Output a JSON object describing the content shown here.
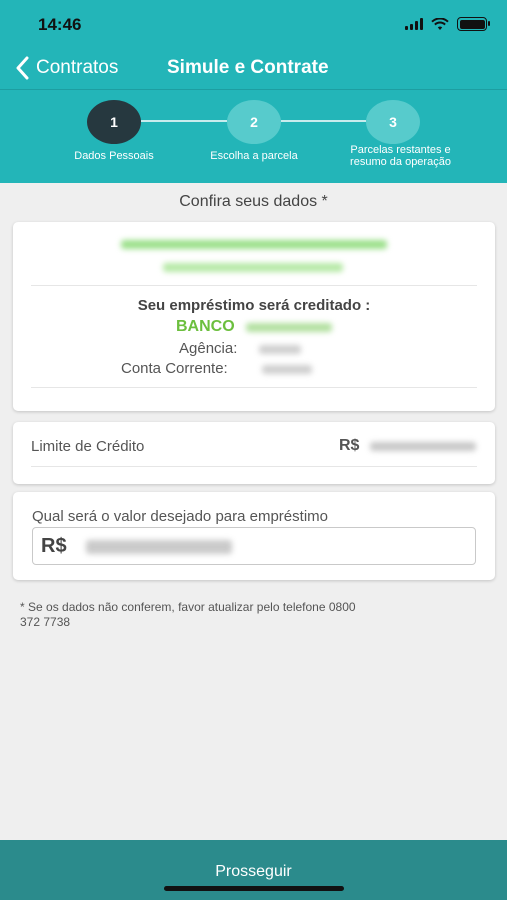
{
  "status_bar": {
    "time": "14:46"
  },
  "nav": {
    "back_label": "Contratos",
    "title": "Simule e Contrate"
  },
  "stepper": {
    "steps": [
      {
        "number": "1",
        "label": "Dados Pessoais",
        "active": true
      },
      {
        "number": "2",
        "label": "Escolha a parcela",
        "active": false
      },
      {
        "number": "3",
        "label_line1": "Parcelas restantes e",
        "label_line2": "resumo da operação",
        "active": false
      }
    ]
  },
  "section_title": "Confira seus dados *",
  "account_card": {
    "credit_heading": "Seu empréstimo será creditado :",
    "bank_label": "BANCO",
    "agency_label": "Agência:",
    "account_label": "Conta Corrente:"
  },
  "credit_limit": {
    "label": "Limite de Crédito",
    "currency": "R$"
  },
  "loan_amount": {
    "label": "Qual será o valor desejado para empréstimo",
    "currency": "R$"
  },
  "footnote": {
    "line1": "* Se os dados não conferem, favor atualizar pelo telefone 0800",
    "line2": "372 7738"
  },
  "footer": {
    "button_label": "Prosseguir"
  },
  "colors": {
    "header_teal": "#23b5b8",
    "active_step": "#26383f",
    "bank_green": "#6cbf3e",
    "footer": "#2b8b8c"
  }
}
